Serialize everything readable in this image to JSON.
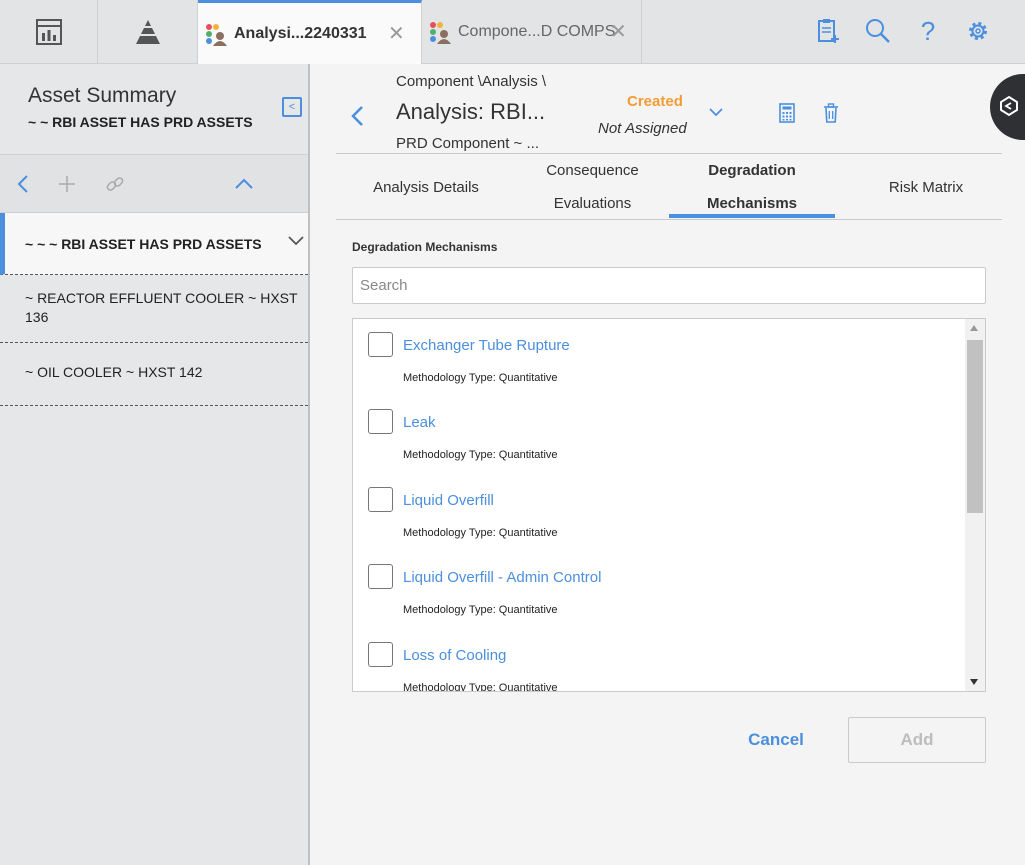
{
  "colors": {
    "accent": "#4b8fde",
    "status_created": "#f39c34",
    "disabled": "#bdbdbd"
  },
  "topbar": {
    "tabs": [
      {
        "label": "Analysi...2240331",
        "active": true
      },
      {
        "label": "Compone...D COMPS",
        "active": false
      }
    ]
  },
  "left": {
    "title": "Asset Summary",
    "subtitle": "~ ~ RBI ASSET HAS PRD ASSETS",
    "tree": [
      {
        "label": "~ ~ ~ RBI ASSET HAS PRD ASSETS"
      },
      {
        "label": "~ REACTOR EFFLUENT COOLER ~ HXST 136"
      },
      {
        "label": "~ OIL COOLER ~ HXST 142"
      }
    ]
  },
  "header": {
    "breadcrumb": "Component \\Analysis \\",
    "title": "Analysis: RBI...",
    "subtitle": "PRD Component ~ ...",
    "state": "Created",
    "assigned": "Not Assigned"
  },
  "tabs": [
    {
      "line1": "Analysis Details",
      "line2": ""
    },
    {
      "line1": "Consequence",
      "line2": "Evaluations"
    },
    {
      "line1": "Degradation",
      "line2": "Mechanisms"
    },
    {
      "line1": "Risk Matrix",
      "line2": ""
    }
  ],
  "panel": {
    "label": "Degradation Mechanisms",
    "search_placeholder": "Search",
    "items": [
      {
        "name": "Exchanger Tube Rupture",
        "methodology": "Methodology Type: Quantitative",
        "checked": false
      },
      {
        "name": "Leak",
        "methodology": "Methodology Type: Quantitative",
        "checked": false
      },
      {
        "name": "Liquid Overfill",
        "methodology": "Methodology Type: Quantitative",
        "checked": false
      },
      {
        "name": "Liquid Overfill - Admin Control",
        "methodology": "Methodology Type: Quantitative",
        "checked": false
      },
      {
        "name": "Loss of Cooling",
        "methodology": "Methodology Type: Quantitative",
        "checked": false
      }
    ],
    "cancel_label": "Cancel",
    "add_label": "Add"
  }
}
